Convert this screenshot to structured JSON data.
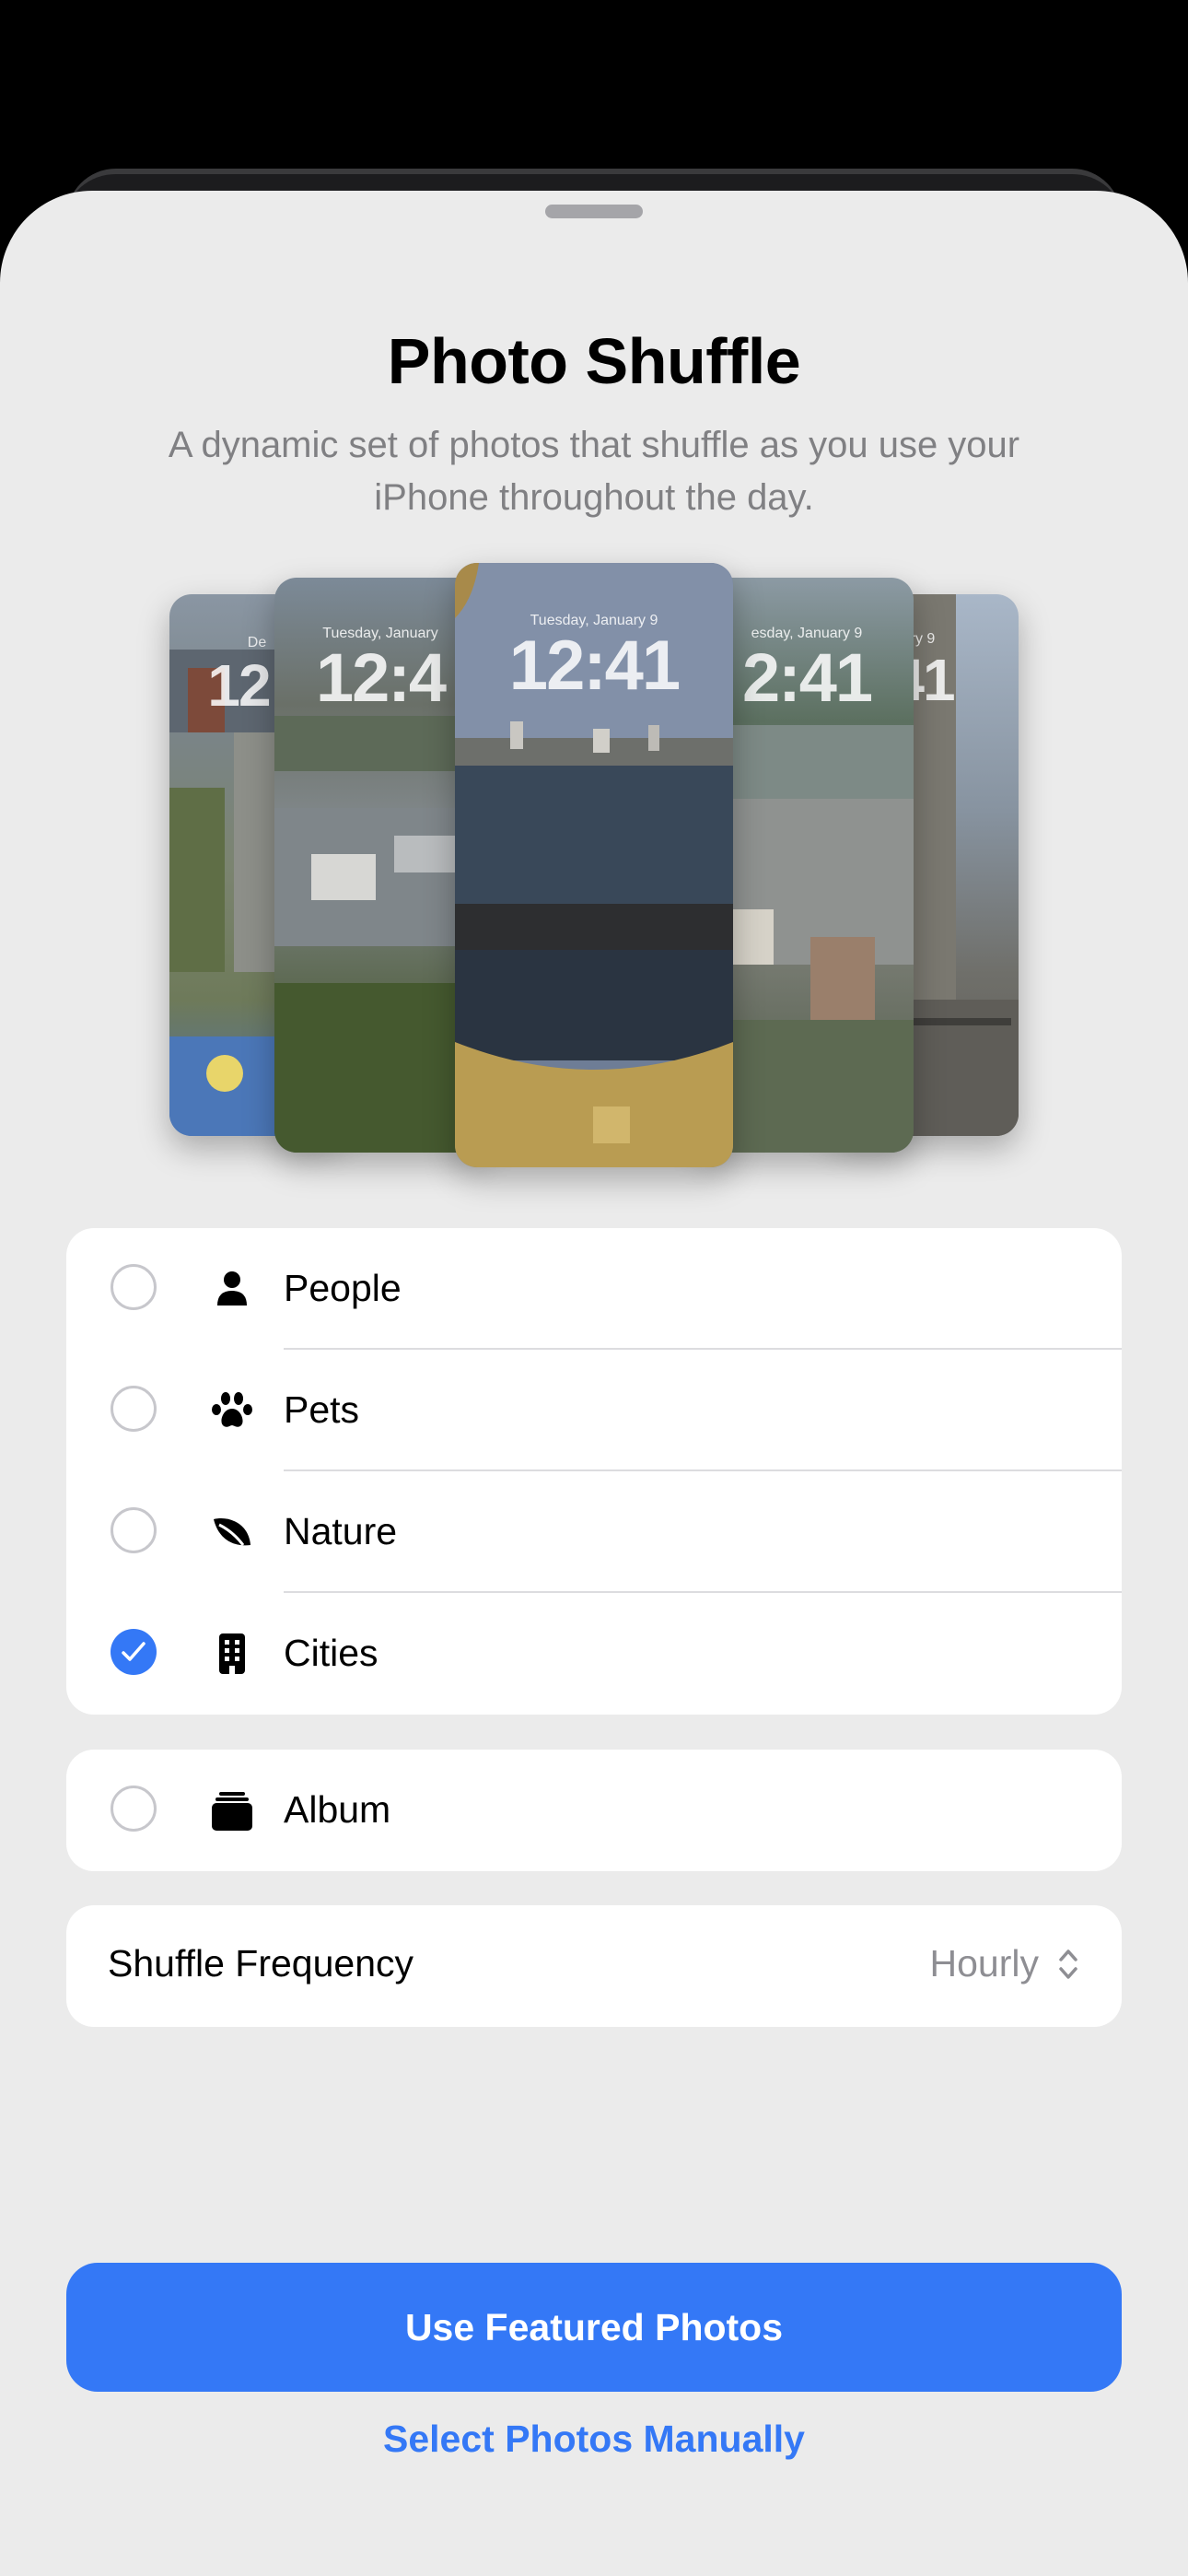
{
  "header": {
    "title": "Photo Shuffle",
    "subtitle_line1": "A dynamic set of photos that shuffle as you use your",
    "subtitle_line2": "iPhone throughout the day."
  },
  "previews": {
    "far_left": {
      "date": "De",
      "time": "12"
    },
    "left": {
      "date": "Tuesday, January",
      "time": "12:4"
    },
    "center": {
      "date": "Tuesday, January 9",
      "time": "12:41"
    },
    "right": {
      "date": "esday, January 9",
      "time": "2:41"
    },
    "far_right": {
      "date": "ry 9",
      "time": "41"
    }
  },
  "categories": [
    {
      "label": "People",
      "icon": "person-icon",
      "selected": false
    },
    {
      "label": "Pets",
      "icon": "pawprint-icon",
      "selected": false
    },
    {
      "label": "Nature",
      "icon": "leaf-icon",
      "selected": false
    },
    {
      "label": "Cities",
      "icon": "building-icon",
      "selected": true
    }
  ],
  "album": {
    "label": "Album",
    "icon": "album-stack-icon",
    "selected": false
  },
  "frequency": {
    "label": "Shuffle Frequency",
    "value": "Hourly"
  },
  "actions": {
    "primary": "Use Featured Photos",
    "secondary": "Select Photos Manually"
  },
  "colors": {
    "accent": "#3478f6",
    "sheet_background": "#ebebeb",
    "secondary_text": "#808083"
  }
}
